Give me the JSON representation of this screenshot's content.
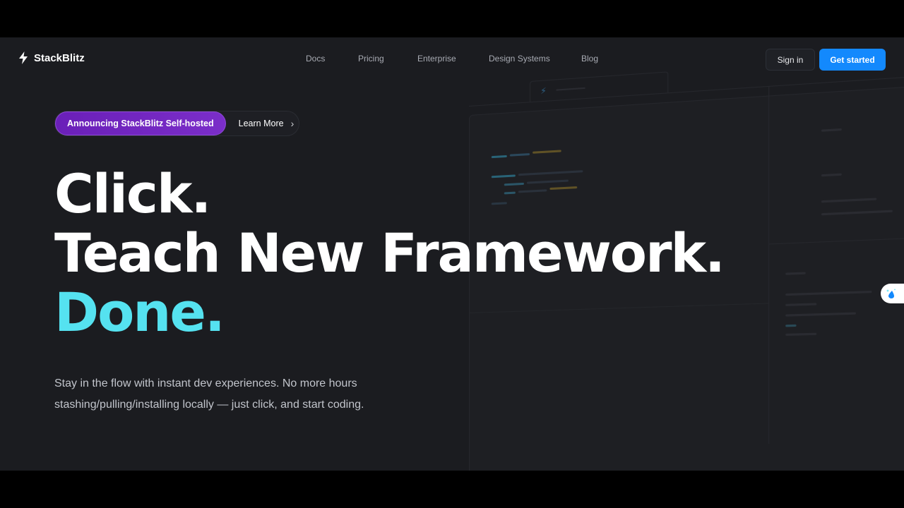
{
  "brand": {
    "name": "StackBlitz",
    "icon": "lightning-bolt-icon"
  },
  "nav": {
    "links": [
      "Docs",
      "Pricing",
      "Enterprise",
      "Design Systems",
      "Blog"
    ],
    "sign_in": "Sign in",
    "get_started": "Get started"
  },
  "announcement": {
    "tag": "Announcing StackBlitz Self-hosted",
    "link": "Learn More",
    "link_icon": "chevron-right-icon"
  },
  "hero": {
    "line1": "Click.",
    "line2": "Teach New Framework.",
    "line3": "Done.",
    "subtitle": "Stay in the flow with instant dev experiences. No more hours stashing/pulling/installing locally — just click, and start coding."
  },
  "widget": {
    "icon": "water-drop-sparkle-icon"
  },
  "colors": {
    "background": "#1b1c20",
    "accent_cyan": "#55e2f0",
    "primary_blue": "#1389fd",
    "announcement_purple": "#6a1fb8"
  }
}
